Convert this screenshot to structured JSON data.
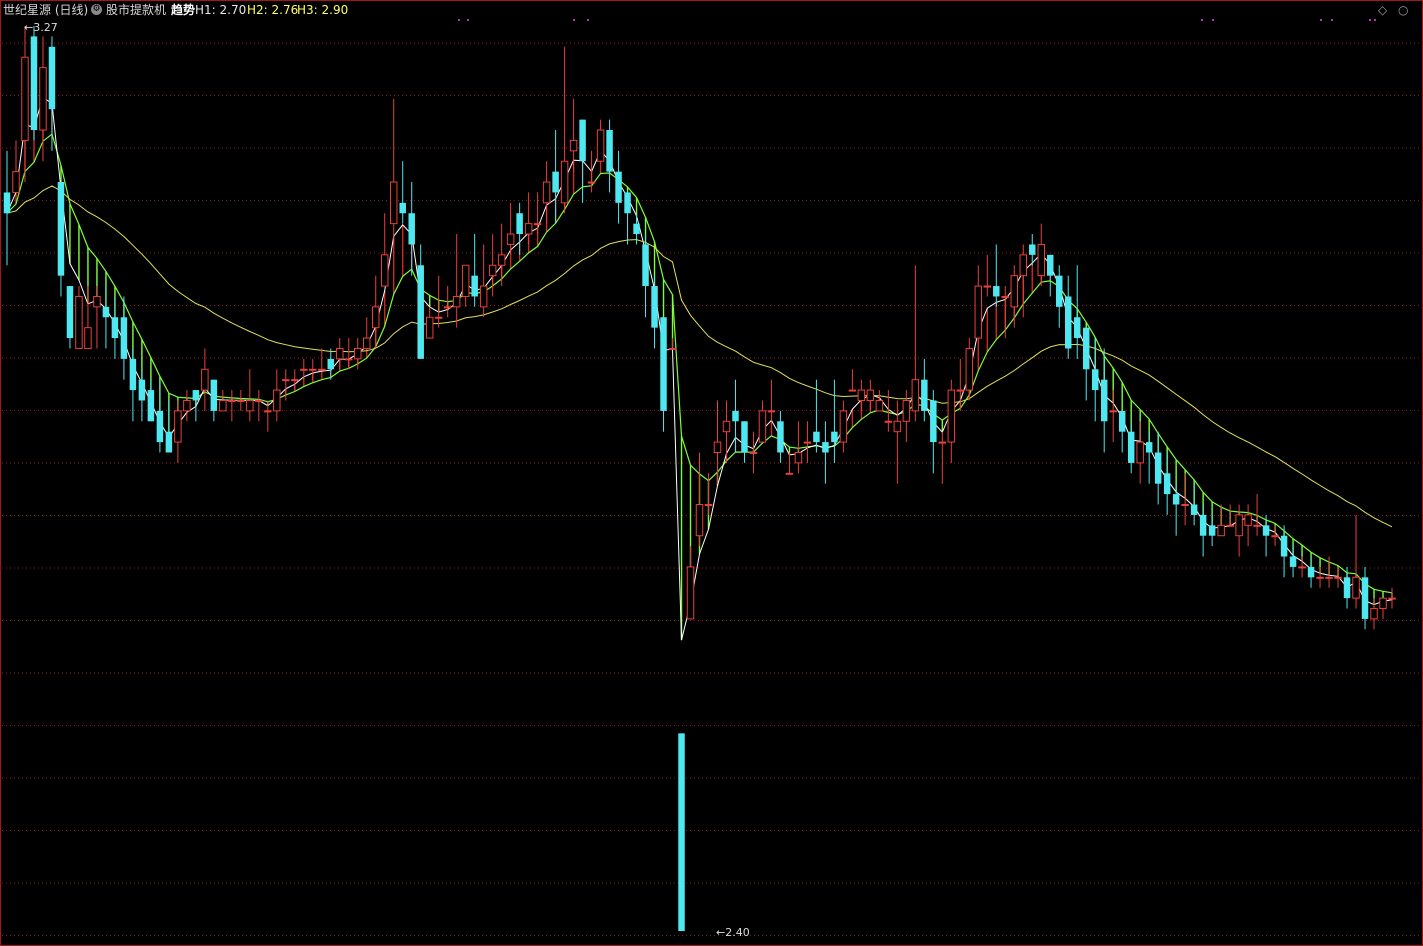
{
  "header": {
    "stock_name": "世纪星源 (日线)",
    "indicator_name": "股市提款机",
    "trend_label": "趋势",
    "h1": "H1: 2.70",
    "h2": "H2: 2.76",
    "h3": "H3: 2.90"
  },
  "controls": {
    "diamond_icon": "◇",
    "circle_icon": "○"
  },
  "colors": {
    "background": "#000000",
    "up_candle": "#e8403a",
    "down_candle": "#4fe8f0",
    "green_band": "#7cff3a",
    "red_band": "#d02a20",
    "long_ma": "#e0e05a",
    "grid": "#8b1a1a"
  },
  "chart_data": {
    "type": "candlestick",
    "price_range": [
      2.4,
      3.27
    ],
    "labels": {
      "high": "3.27",
      "low": "2.40"
    },
    "grid": "dotted horizontal",
    "candles": [
      [
        3.11,
        3.09,
        3.15,
        3.04
      ],
      [
        3.11,
        3.13,
        3.16,
        3.12
      ],
      [
        3.16,
        3.24,
        3.27,
        3.12
      ],
      [
        3.26,
        3.17,
        3.27,
        3.16
      ],
      [
        3.17,
        3.23,
        3.26,
        3.14
      ],
      [
        3.25,
        3.19,
        3.26,
        3.15
      ],
      [
        3.12,
        3.03,
        3.12,
        3.01
      ],
      [
        3.02,
        2.97,
        3.02,
        2.96
      ],
      [
        2.96,
        3.01,
        3.02,
        2.96
      ],
      [
        2.96,
        2.98,
        3.02,
        2.96
      ],
      [
        3.0,
        3.01,
        3.02,
        2.96
      ],
      [
        3.0,
        2.99,
        3.02,
        2.96
      ],
      [
        2.99,
        2.97,
        3.01,
        2.95
      ],
      [
        2.99,
        2.95,
        3.01,
        2.93
      ],
      [
        2.95,
        2.92,
        2.96,
        2.89
      ],
      [
        2.93,
        2.91,
        2.94,
        2.89
      ],
      [
        2.92,
        2.89,
        2.93,
        2.89
      ],
      [
        2.9,
        2.87,
        2.93,
        2.86
      ],
      [
        2.88,
        2.86,
        2.91,
        2.86
      ],
      [
        2.87,
        2.9,
        2.91,
        2.85
      ],
      [
        2.9,
        2.91,
        2.92,
        2.89
      ],
      [
        2.92,
        2.91,
        2.92,
        2.89
      ],
      [
        2.92,
        2.94,
        2.96,
        2.9
      ],
      [
        2.93,
        2.9,
        2.93,
        2.89
      ],
      [
        2.9,
        2.91,
        2.92,
        2.9
      ],
      [
        2.91,
        2.91,
        2.92,
        2.89
      ],
      [
        2.91,
        2.91,
        2.92,
        2.9
      ],
      [
        2.9,
        2.91,
        2.94,
        2.89
      ],
      [
        2.91,
        2.91,
        2.92,
        2.89
      ],
      [
        2.9,
        2.9,
        2.91,
        2.88
      ],
      [
        2.9,
        2.92,
        2.94,
        2.89
      ],
      [
        2.93,
        2.93,
        2.94,
        2.91
      ],
      [
        2.93,
        2.93,
        2.94,
        2.92
      ],
      [
        2.94,
        2.94,
        2.95,
        2.93
      ],
      [
        2.94,
        2.94,
        2.95,
        2.93
      ],
      [
        2.94,
        2.94,
        2.96,
        2.94
      ],
      [
        2.95,
        2.94,
        2.96,
        2.93
      ],
      [
        2.95,
        2.96,
        2.97,
        2.94
      ],
      [
        2.95,
        2.95,
        2.97,
        2.94
      ],
      [
        2.95,
        2.96,
        2.97,
        2.94
      ],
      [
        2.96,
        2.97,
        2.99,
        2.96
      ],
      [
        2.98,
        3.0,
        3.03,
        2.96
      ],
      [
        3.02,
        3.05,
        3.09,
        3.02
      ],
      [
        3.08,
        3.12,
        3.2,
        3.06
      ],
      [
        3.1,
        3.09,
        3.14,
        3.08
      ],
      [
        3.09,
        3.06,
        3.12,
        3.03
      ],
      [
        3.04,
        2.95,
        3.06,
        2.95
      ],
      [
        2.97,
        2.99,
        3.0,
        2.97
      ],
      [
        2.99,
        2.99,
        3.03,
        2.98
      ],
      [
        3.0,
        3.0,
        3.02,
        2.99
      ],
      [
        3.0,
        3.01,
        3.07,
        2.98
      ],
      [
        3.01,
        3.04,
        3.04,
        3.0
      ],
      [
        3.03,
        3.01,
        3.07,
        3.0
      ],
      [
        3.0,
        3.02,
        3.06,
        2.99
      ],
      [
        3.03,
        3.04,
        3.07,
        3.01
      ],
      [
        3.04,
        3.05,
        3.08,
        3.02
      ],
      [
        3.06,
        3.07,
        3.1,
        3.05
      ],
      [
        3.09,
        3.07,
        3.1,
        3.05
      ],
      [
        3.07,
        3.08,
        3.11,
        3.06
      ],
      [
        3.08,
        3.08,
        3.11,
        3.07
      ],
      [
        3.1,
        3.12,
        3.14,
        3.08
      ],
      [
        3.13,
        3.11,
        3.17,
        3.08
      ],
      [
        3.1,
        3.14,
        3.25,
        3.09
      ],
      [
        3.15,
        3.16,
        3.2,
        3.13
      ],
      [
        3.18,
        3.14,
        3.18,
        3.1
      ],
      [
        3.12,
        3.12,
        3.15,
        3.11
      ],
      [
        3.14,
        3.17,
        3.18,
        3.14
      ],
      [
        3.17,
        3.13,
        3.18,
        3.11
      ],
      [
        3.13,
        3.1,
        3.15,
        3.08
      ],
      [
        3.11,
        3.09,
        3.11,
        3.06
      ],
      [
        3.08,
        3.07,
        3.09,
        3.06
      ],
      [
        3.06,
        3.02,
        3.07,
        2.99
      ],
      [
        3.02,
        2.98,
        3.03,
        2.96
      ],
      [
        2.99,
        2.9,
        2.99,
        2.88
      ],
      [
        2.96,
        2.96,
        2.97,
        2.96
      ],
      [
        2.59,
        2.4,
        2.4,
        2.76
      ],
      [
        2.7,
        2.75,
        2.77,
        2.73
      ],
      [
        2.78,
        2.81,
        2.86,
        2.77
      ],
      [
        2.81,
        2.81,
        2.84,
        2.8
      ],
      [
        2.86,
        2.87,
        2.91,
        2.83
      ],
      [
        2.88,
        2.89,
        2.91,
        2.85
      ],
      [
        2.9,
        2.89,
        2.93,
        2.86
      ],
      [
        2.89,
        2.86,
        2.89,
        2.85
      ],
      [
        2.86,
        2.86,
        2.88,
        2.84
      ],
      [
        2.87,
        2.9,
        2.91,
        2.87
      ],
      [
        2.9,
        2.9,
        2.93,
        2.89
      ],
      [
        2.89,
        2.86,
        2.9,
        2.85
      ],
      [
        2.84,
        2.84,
        2.86,
        2.85
      ],
      [
        2.85,
        2.86,
        2.89,
        2.84
      ],
      [
        2.87,
        2.87,
        2.89,
        2.85
      ],
      [
        2.88,
        2.87,
        2.93,
        2.86
      ],
      [
        2.87,
        2.86,
        2.89,
        2.83
      ],
      [
        2.88,
        2.87,
        2.93,
        2.85
      ],
      [
        2.87,
        2.9,
        2.91,
        2.86
      ],
      [
        2.92,
        2.92,
        2.94,
        2.92
      ],
      [
        2.91,
        2.92,
        2.93,
        2.9
      ],
      [
        2.91,
        2.92,
        2.93,
        2.9
      ],
      [
        2.9,
        2.91,
        2.92,
        2.9
      ],
      [
        2.89,
        2.89,
        2.92,
        2.88
      ],
      [
        2.88,
        2.89,
        2.91,
        2.83
      ],
      [
        2.89,
        2.91,
        2.92,
        2.87
      ],
      [
        2.9,
        2.93,
        3.04,
        2.89
      ],
      [
        2.93,
        2.9,
        2.95,
        2.89
      ],
      [
        2.91,
        2.87,
        2.92,
        2.84
      ],
      [
        2.87,
        2.87,
        2.88,
        2.83
      ],
      [
        2.87,
        2.92,
        2.93,
        2.85
      ],
      [
        2.92,
        2.92,
        2.95,
        2.9
      ],
      [
        2.92,
        2.96,
        2.97,
        2.91
      ],
      [
        2.97,
        3.02,
        3.04,
        2.97
      ],
      [
        3.02,
        3.02,
        3.05,
        3.01
      ],
      [
        3.02,
        3.01,
        3.06,
        3.0
      ],
      [
        3.01,
        3.01,
        3.02,
        2.97
      ],
      [
        3.0,
        3.03,
        3.04,
        2.98
      ],
      [
        3.03,
        3.05,
        3.06,
        2.99
      ],
      [
        3.06,
        3.05,
        3.07,
        3.04
      ],
      [
        3.03,
        3.06,
        3.08,
        3.02
      ],
      [
        3.05,
        3.03,
        3.05,
        3.01
      ],
      [
        3.03,
        3.0,
        3.04,
        2.98
      ],
      [
        3.01,
        2.96,
        3.03,
        2.95
      ],
      [
        2.99,
        2.97,
        3.04,
        2.95
      ],
      [
        2.98,
        2.94,
        2.98,
        2.91
      ],
      [
        2.94,
        2.92,
        2.97,
        2.89
      ],
      [
        2.93,
        2.89,
        2.96,
        2.86
      ],
      [
        2.9,
        2.9,
        2.92,
        2.87
      ],
      [
        2.9,
        2.88,
        2.9,
        2.86
      ],
      [
        2.88,
        2.85,
        2.89,
        2.84
      ],
      [
        2.85,
        2.87,
        2.89,
        2.83
      ],
      [
        2.87,
        2.86,
        2.88,
        2.83
      ],
      [
        2.86,
        2.83,
        2.88,
        2.81
      ],
      [
        2.84,
        2.82,
        2.86,
        2.8
      ],
      [
        2.82,
        2.81,
        2.83,
        2.78
      ],
      [
        2.81,
        2.81,
        2.84,
        2.79
      ],
      [
        2.81,
        2.8,
        2.83,
        2.79
      ],
      [
        2.8,
        2.78,
        2.81,
        2.76
      ],
      [
        2.79,
        2.78,
        2.8,
        2.77
      ],
      [
        2.78,
        2.79,
        2.81,
        2.78
      ],
      [
        2.79,
        2.79,
        2.81,
        2.79
      ],
      [
        2.78,
        2.8,
        2.81,
        2.76
      ],
      [
        2.79,
        2.8,
        2.81,
        2.77
      ],
      [
        2.79,
        2.79,
        2.82,
        2.78
      ],
      [
        2.79,
        2.78,
        2.8,
        2.76
      ],
      [
        2.78,
        2.78,
        2.79,
        2.77
      ],
      [
        2.78,
        2.76,
        2.79,
        2.74
      ],
      [
        2.76,
        2.75,
        2.77,
        2.74
      ],
      [
        2.75,
        2.75,
        2.76,
        2.74
      ],
      [
        2.75,
        2.74,
        2.76,
        2.73
      ],
      [
        2.74,
        2.74,
        2.75,
        2.73
      ],
      [
        2.74,
        2.74,
        2.76,
        2.73
      ],
      [
        2.74,
        2.74,
        2.75,
        2.73
      ],
      [
        2.74,
        2.72,
        2.75,
        2.71
      ],
      [
        2.72,
        2.74,
        2.8,
        2.71
      ],
      [
        2.74,
        2.7,
        2.75,
        2.69
      ],
      [
        2.7,
        2.71,
        2.72,
        2.69
      ],
      [
        2.71,
        2.72,
        2.72,
        2.7
      ],
      [
        2.72,
        2.72,
        2.73,
        2.71
      ]
    ]
  }
}
